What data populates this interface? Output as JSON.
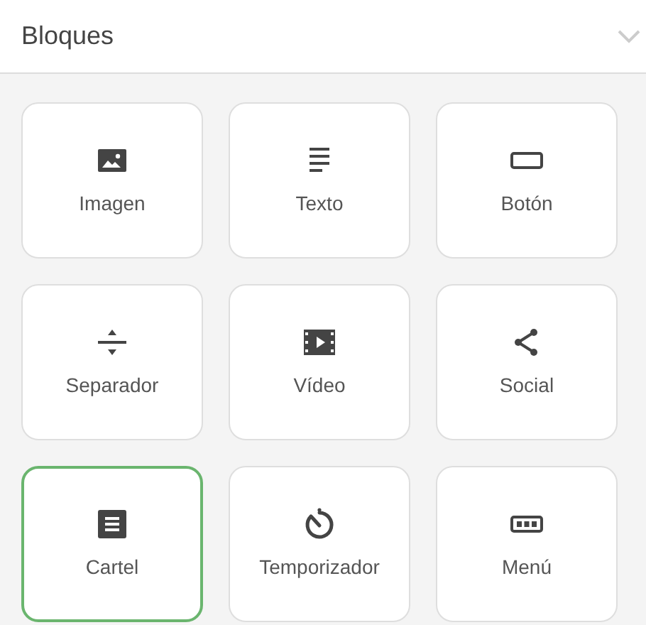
{
  "panel": {
    "title": "Bloques",
    "expanded": true
  },
  "blocks": [
    {
      "kind": "image",
      "label": "Imagen",
      "selected": false
    },
    {
      "kind": "text",
      "label": "Texto",
      "selected": false
    },
    {
      "kind": "button",
      "label": "Botón",
      "selected": false
    },
    {
      "kind": "divider",
      "label": "Separador",
      "selected": false
    },
    {
      "kind": "video",
      "label": "Vídeo",
      "selected": false
    },
    {
      "kind": "social",
      "label": "Social",
      "selected": false
    },
    {
      "kind": "banner",
      "label": "Cartel",
      "selected": true
    },
    {
      "kind": "timer",
      "label": "Temporizador",
      "selected": false
    },
    {
      "kind": "menu",
      "label": "Menú",
      "selected": false
    }
  ]
}
